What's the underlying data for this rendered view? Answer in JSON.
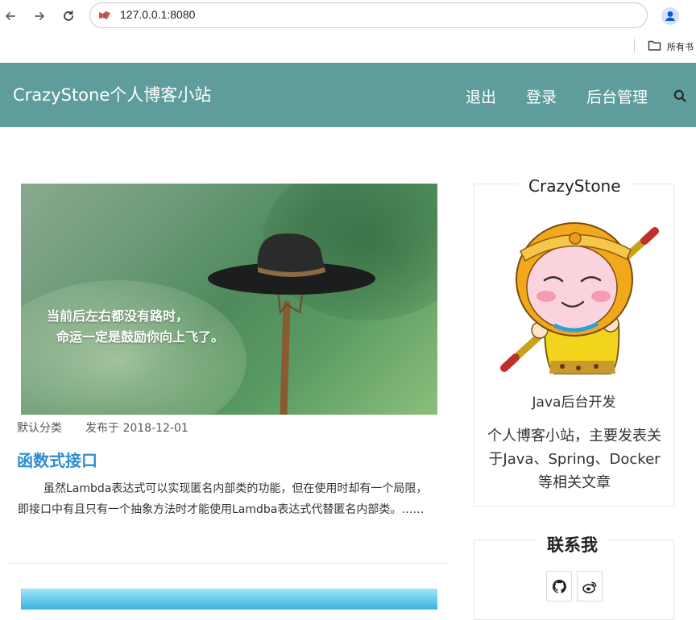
{
  "browser": {
    "url": "127.0.0.1:8080",
    "bookmarks_folder_label": "所有书"
  },
  "header": {
    "brand": "CrazyStone个人博客小站",
    "nav": [
      "退出",
      "登录",
      "后台管理"
    ]
  },
  "post": {
    "image_text_line1": "当前后左右都没有路时，",
    "image_text_line2": "命运一定是鼓励你向上飞了。",
    "category": "默认分类",
    "published": "发布于 2018-12-01",
    "title": "函数式接口",
    "excerpt": "虽然Lambda表达式可以实现匿名内部类的功能，但在使用时却有一个局限，即接口中有且只有一个抽象方法时才能使用Lamdba表达式代替匿名内部类。……"
  },
  "sidebar": {
    "author_name": "CrazyStone",
    "author_role": "Java后台开发",
    "author_desc": "个人博客小站，主要发表关于Java、Spring、Docker等相关文章",
    "contact_title": "联系我"
  },
  "icons": [
    "back-arrow-icon",
    "forward-arrow-icon",
    "reload-icon",
    "site-icon",
    "profile-icon",
    "folder-icon",
    "search-icon",
    "github-icon",
    "weibo-icon"
  ],
  "colors": {
    "header_bg": "#5f9c9c",
    "post_title": "#2d8dd0"
  }
}
